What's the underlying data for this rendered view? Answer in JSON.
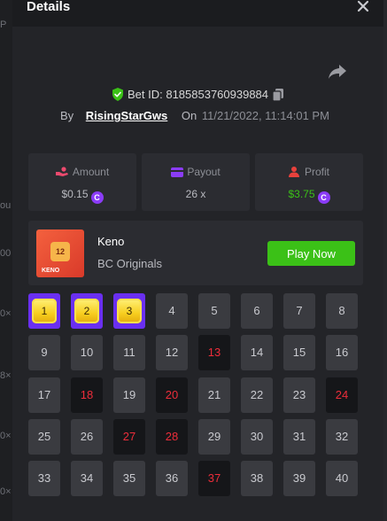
{
  "background": {
    "tick_labels": [
      "P",
      "ou",
      "00",
      "0×",
      "8×",
      "0×",
      "0×"
    ]
  },
  "header": {
    "title": "Details"
  },
  "bet": {
    "id_label": "Bet ID: 8185853760939884",
    "by_label": "By",
    "username": "RisingStarGws",
    "on_label": "On",
    "timestamp": "11/21/2022, 11:14:01 PM"
  },
  "stats": [
    {
      "label": "Amount",
      "value": "$0.15",
      "color": "#b9bac0",
      "icon": "amount-hand-icon"
    },
    {
      "label": "Payout",
      "value": "26 x",
      "color": "#b9bac0",
      "icon": "payout-card-icon"
    },
    {
      "label": "Profit",
      "value": "$3.75",
      "color": "#3bc117",
      "icon": "profit-user-icon"
    }
  ],
  "game": {
    "name": "Keno",
    "provider": "BC Originals",
    "play_label": "Play Now",
    "thumb_ball": "12",
    "thumb_brand": "KENO"
  },
  "keno_grid": {
    "numbers": [
      1,
      2,
      3,
      4,
      5,
      6,
      7,
      8,
      9,
      10,
      11,
      12,
      13,
      14,
      15,
      16,
      17,
      18,
      19,
      20,
      21,
      22,
      23,
      24,
      25,
      26,
      27,
      28,
      29,
      30,
      31,
      32,
      33,
      34,
      35,
      36,
      37,
      38,
      39,
      40
    ],
    "picked": [
      1,
      2,
      3
    ],
    "drawn": [
      13,
      18,
      20,
      24,
      27,
      28,
      37
    ]
  },
  "colors": {
    "accent_purple": "#6a2ff0",
    "play_green": "#3bc117",
    "hit_red": "#ed2d3a",
    "shield_green": "#3bc117"
  }
}
